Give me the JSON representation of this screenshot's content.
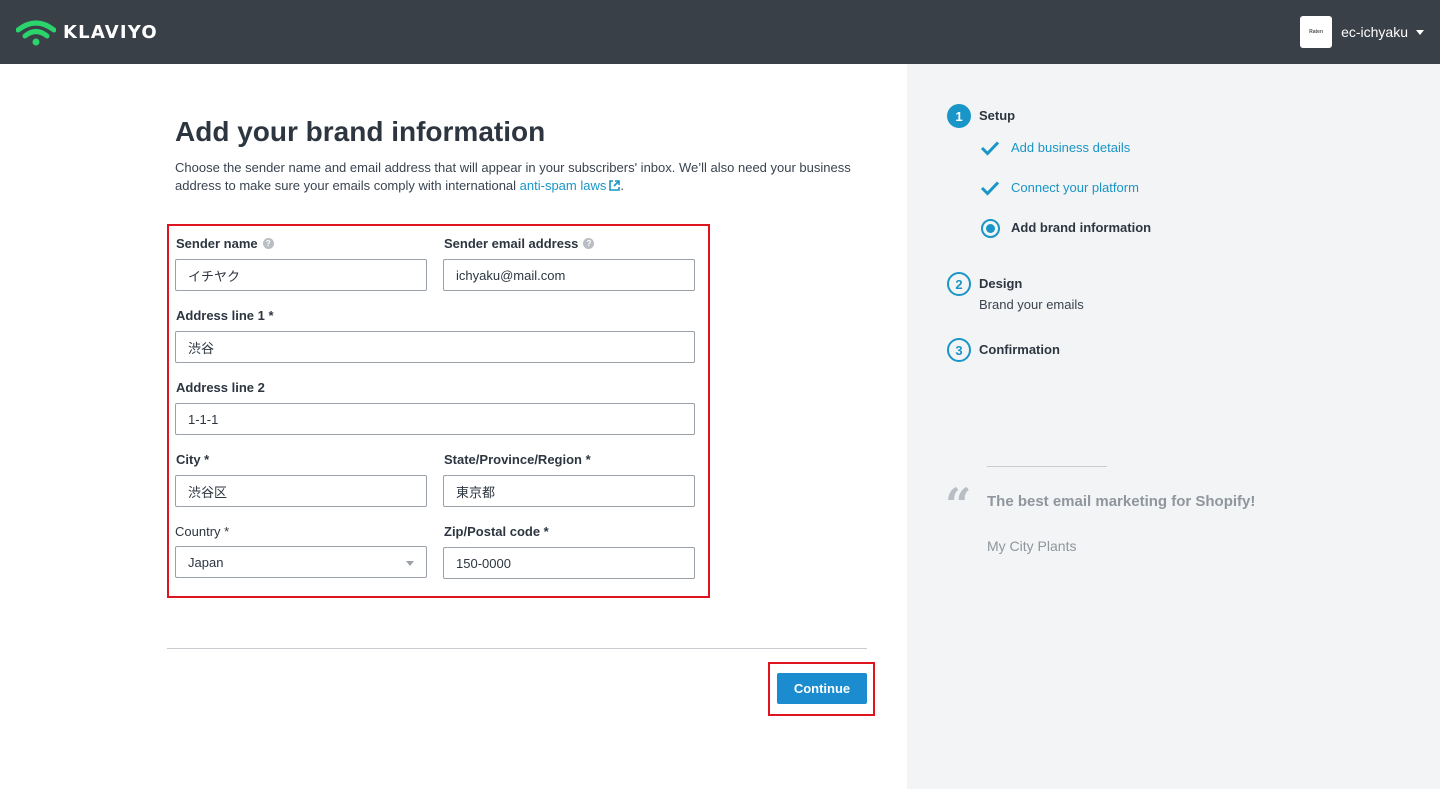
{
  "header": {
    "logo_text": "KLAVIYO",
    "account_name": "ec-ichyaku",
    "avatar_text": "Raten",
    "brand_color": "#2bd36b"
  },
  "main": {
    "title": "Add your brand information",
    "description_pre": "Choose the sender name and email address that will appear in your subscribers' inbox. We’ll also need your business address to make sure your emails comply with international ",
    "description_link": "anti-spam laws",
    "description_post": ".",
    "form": {
      "sender_name": {
        "label": "Sender name",
        "value": "イチヤク"
      },
      "sender_email": {
        "label": "Sender email address",
        "value": "ichyaku@mail.com"
      },
      "address1": {
        "label": "Address line 1 *",
        "value": "渋谷"
      },
      "address2": {
        "label": "Address line 2",
        "value": "1-1-1"
      },
      "city": {
        "label": "City *",
        "value": "渋谷区"
      },
      "state": {
        "label": "State/Province/Region *",
        "value": "東京都"
      },
      "country": {
        "label": "Country *",
        "value": "Japan"
      },
      "zip": {
        "label": "Zip/Postal code *",
        "value": "150-0000"
      }
    },
    "continue_label": "Continue"
  },
  "sidebar": {
    "steps": [
      {
        "number": "1",
        "title": "Setup"
      },
      {
        "number": "2",
        "title": "Design",
        "subtitle": "Brand your emails"
      },
      {
        "number": "3",
        "title": "Confirmation"
      }
    ],
    "substeps": [
      {
        "label": "Add business details"
      },
      {
        "label": "Connect your platform"
      },
      {
        "label": "Add brand information"
      }
    ],
    "quote_mark": "“",
    "quote": "The best email marketing for Shopify!",
    "quote_author": "My City Plants"
  }
}
